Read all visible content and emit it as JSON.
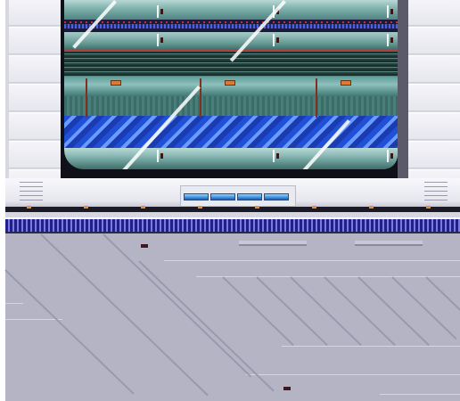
{
  "scene": {
    "colors": {
      "wall": "#f4f4f8",
      "window_frame": "#101018",
      "train_teal": "#7fb0ac",
      "train_blue": "#2050d8",
      "rail_blue": "#20208a",
      "floor": "#b4b4c4",
      "marker_orange": "#e88a40"
    },
    "elements": [
      "wall",
      "window",
      "train",
      "ledge",
      "indicator-panel",
      "rail",
      "floor"
    ],
    "indicator_panel": {
      "segments_lit": 4,
      "segments_total": 4
    }
  }
}
